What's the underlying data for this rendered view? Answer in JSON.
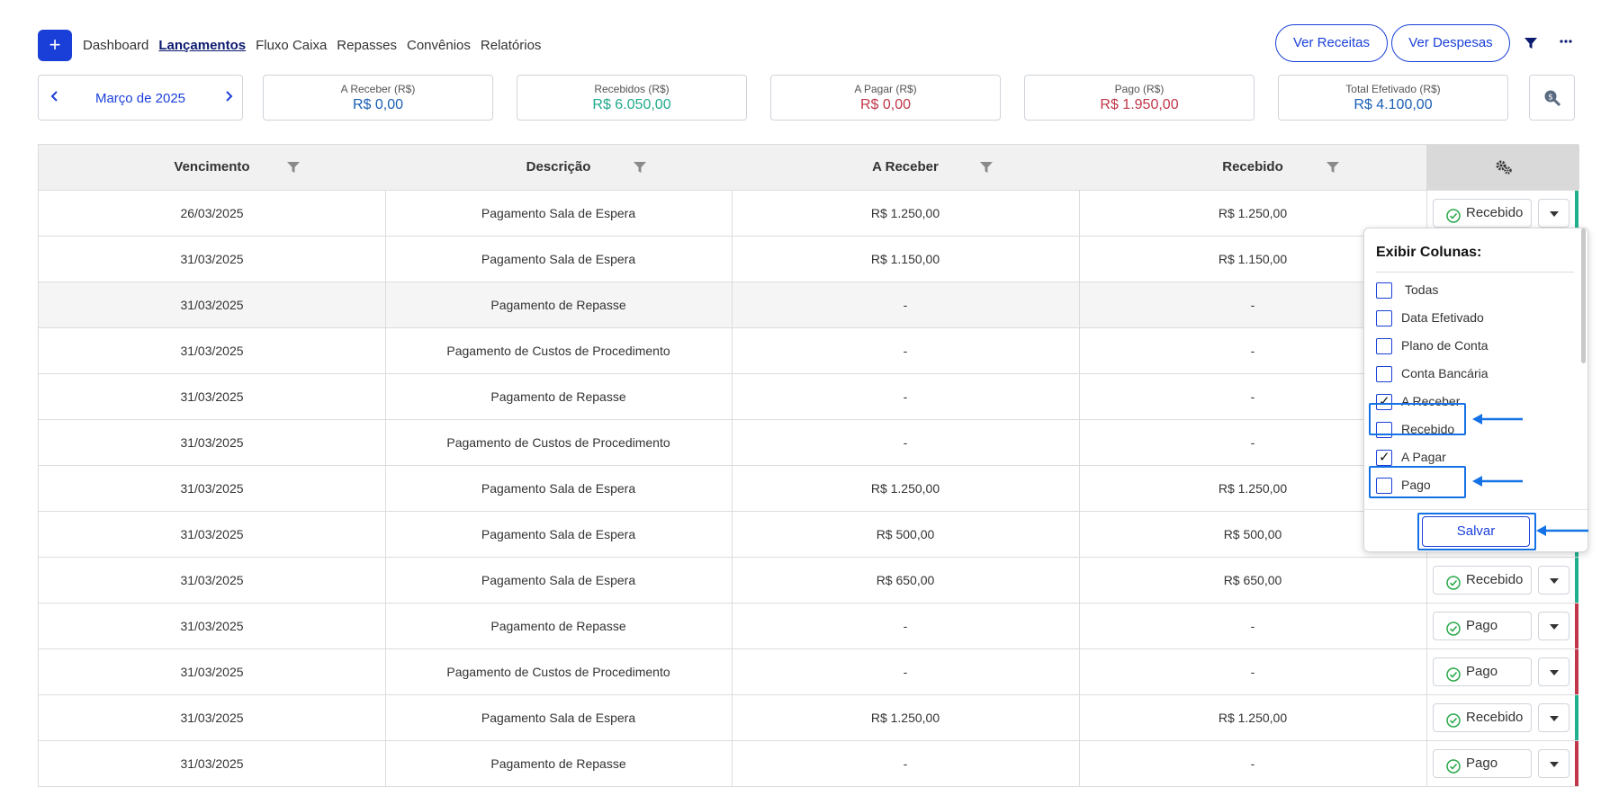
{
  "nav": {
    "add_label": "+",
    "items": [
      "Dashboard",
      "Lançamentos",
      "Fluxo Caixa",
      "Repasses",
      "Convênios",
      "Relatórios"
    ],
    "active_index": 1
  },
  "actions": {
    "ver_receitas": "Ver Receitas",
    "ver_despesas": "Ver Despesas"
  },
  "period": {
    "label": "Março de 2025"
  },
  "summary": [
    {
      "title": "A Receber (R$)",
      "value": "R$ 0,00",
      "color": "#1a5fb4"
    },
    {
      "title": "Recebidos (R$)",
      "value": "R$ 6.050,00",
      "color": "#20a98b"
    },
    {
      "title": "A Pagar (R$)",
      "value": "R$ 0,00",
      "color": "#c0364a"
    },
    {
      "title": "Pago (R$)",
      "value": "R$ 1.950,00",
      "color": "#c0364a"
    },
    {
      "title": "Total Efetivado (R$)",
      "value": "R$ 4.100,00",
      "color": "#1a5fb4"
    }
  ],
  "table": {
    "columns": [
      "Vencimento",
      "Descrição",
      "A Receber",
      "Recebido"
    ],
    "rows": [
      {
        "vencimento": "26/03/2025",
        "descricao": "Pagamento Sala de Espera",
        "a_receber": "R$ 1.250,00",
        "recebido": "R$ 1.250,00",
        "status": "Recebido",
        "kind": "in"
      },
      {
        "vencimento": "31/03/2025",
        "descricao": "Pagamento Sala de Espera",
        "a_receber": "R$ 1.150,00",
        "recebido": "R$ 1.150,00",
        "status": "",
        "kind": "in"
      },
      {
        "vencimento": "31/03/2025",
        "descricao": "Pagamento de Repasse",
        "a_receber": "-",
        "recebido": "-",
        "status": "",
        "kind": "out"
      },
      {
        "vencimento": "31/03/2025",
        "descricao": "Pagamento de Custos de Procedimento",
        "a_receber": "-",
        "recebido": "-",
        "status": "",
        "kind": "out"
      },
      {
        "vencimento": "31/03/2025",
        "descricao": "Pagamento de Repasse",
        "a_receber": "-",
        "recebido": "-",
        "status": "",
        "kind": "out"
      },
      {
        "vencimento": "31/03/2025",
        "descricao": "Pagamento de Custos de Procedimento",
        "a_receber": "-",
        "recebido": "-",
        "status": "",
        "kind": "out"
      },
      {
        "vencimento": "31/03/2025",
        "descricao": "Pagamento Sala de Espera",
        "a_receber": "R$ 1.250,00",
        "recebido": "R$ 1.250,00",
        "status": "",
        "kind": "in"
      },
      {
        "vencimento": "31/03/2025",
        "descricao": "Pagamento Sala de Espera",
        "a_receber": "R$ 500,00",
        "recebido": "R$ 500,00",
        "status": "",
        "kind": "in"
      },
      {
        "vencimento": "31/03/2025",
        "descricao": "Pagamento Sala de Espera",
        "a_receber": "R$ 650,00",
        "recebido": "R$ 650,00",
        "status": "Recebido",
        "kind": "in"
      },
      {
        "vencimento": "31/03/2025",
        "descricao": "Pagamento de Repasse",
        "a_receber": "-",
        "recebido": "-",
        "status": "Pago",
        "kind": "out"
      },
      {
        "vencimento": "31/03/2025",
        "descricao": "Pagamento de Custos de Procedimento",
        "a_receber": "-",
        "recebido": "-",
        "status": "Pago",
        "kind": "out"
      },
      {
        "vencimento": "31/03/2025",
        "descricao": "Pagamento Sala de Espera",
        "a_receber": "R$ 1.250,00",
        "recebido": "R$ 1.250,00",
        "status": "Recebido",
        "kind": "in"
      },
      {
        "vencimento": "31/03/2025",
        "descricao": "Pagamento de Repasse",
        "a_receber": "-",
        "recebido": "-",
        "status": "Pago",
        "kind": "out"
      }
    ]
  },
  "column_popup": {
    "title": "Exibir Colunas:",
    "options": [
      {
        "label": "Todas",
        "checked": false
      },
      {
        "label": "Data Efetivado",
        "checked": false
      },
      {
        "label": "Plano de Conta",
        "checked": false
      },
      {
        "label": "Conta Bancária",
        "checked": false
      },
      {
        "label": "A Receber",
        "checked": true
      },
      {
        "label": "Recebido",
        "checked": false
      },
      {
        "label": "A Pagar",
        "checked": true
      },
      {
        "label": "Pago",
        "checked": false
      }
    ],
    "save_label": "Salvar"
  },
  "colors": {
    "primary": "#1a3fd9",
    "received_bar": "#20b08e",
    "paid_bar": "#c0364a",
    "annotation": "#1472e6"
  }
}
